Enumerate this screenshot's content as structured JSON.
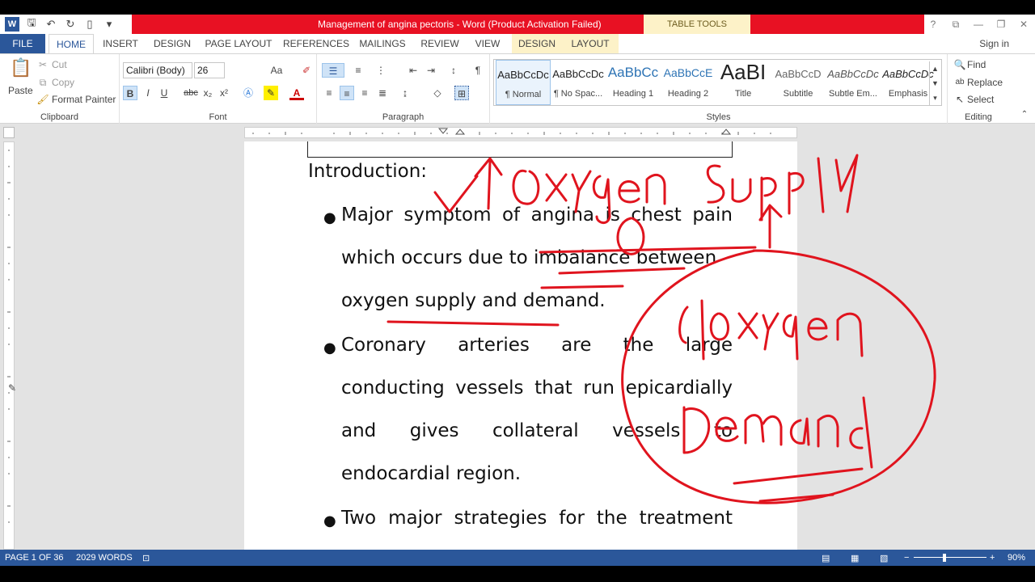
{
  "window": {
    "title": "Management of angina pectoris - Word (Product Activation Failed)",
    "contextual_tab_group": "TABLE TOOLS",
    "controls": [
      "?",
      "⧉",
      "—",
      "❐",
      "✕"
    ]
  },
  "tabs": [
    "FILE",
    "HOME",
    "INSERT",
    "DESIGN",
    "PAGE LAYOUT",
    "REFERENCES",
    "MAILINGS",
    "REVIEW",
    "VIEW"
  ],
  "contextual_tabs": [
    "DESIGN",
    "LAYOUT"
  ],
  "signin": "Sign in",
  "clipboard": {
    "paste": "Paste",
    "cut": "Cut",
    "copy": "Copy",
    "format_painter": "Format Painter",
    "label": "Clipboard"
  },
  "font": {
    "name": "Calibri (Body)",
    "size": "26",
    "label": "Font",
    "bold": "B",
    "italic": "I",
    "underline": "U",
    "strike": "abc",
    "sub": "x₂",
    "sup": "x²",
    "grow": "Aa",
    "color": "A"
  },
  "paragraph": {
    "label": "Paragraph",
    "pilcrow": "¶"
  },
  "styles": {
    "label": "Styles",
    "items": [
      {
        "preview": "AaBbCcDc",
        "name": "¶ Normal"
      },
      {
        "preview": "AaBbCcDc",
        "name": "¶ No Spac..."
      },
      {
        "preview": "AaBbCc",
        "name": "Heading 1"
      },
      {
        "preview": "AaBbCcE",
        "name": "Heading 2"
      },
      {
        "preview": "AaBI",
        "name": "Title"
      },
      {
        "preview": "AaBbCcD",
        "name": "Subtitle"
      },
      {
        "preview": "AaBbCcDc",
        "name": "Subtle Em..."
      },
      {
        "preview": "AaBbCcDc",
        "name": "Emphasis"
      }
    ]
  },
  "editing": {
    "label": "Editing",
    "find": "Find",
    "replace": "Replace",
    "select": "Select"
  },
  "document": {
    "heading": "Introduction:",
    "lines": [
      {
        "words": [
          "Major",
          "symptom",
          "of",
          "angina",
          "is",
          "chest",
          "pain"
        ],
        "bullet": true
      },
      {
        "words": [
          "which occurs due to imbalance between"
        ],
        "bullet": false
      },
      {
        "words": [
          "oxygen supply and demand."
        ],
        "bullet": false
      },
      {
        "words": [
          "Coronary",
          "arteries",
          "are",
          "the",
          "large"
        ],
        "bullet": true
      },
      {
        "words": [
          "conducting",
          "vessels",
          "that",
          "run",
          "epicardially"
        ],
        "bullet": false
      },
      {
        "words": [
          "and",
          "gives",
          "collateral",
          "vessels",
          "to"
        ],
        "bullet": false
      },
      {
        "words": [
          "endocardial region."
        ],
        "bullet": false
      },
      {
        "words": [
          "Two",
          "major",
          "strategies",
          "for",
          "the",
          "treatment"
        ],
        "bullet": true
      }
    ]
  },
  "status": {
    "page": "PAGE 1 OF 36",
    "words": "2029 WORDS",
    "zoom": "90%"
  },
  "ink_color": "#e0141e"
}
